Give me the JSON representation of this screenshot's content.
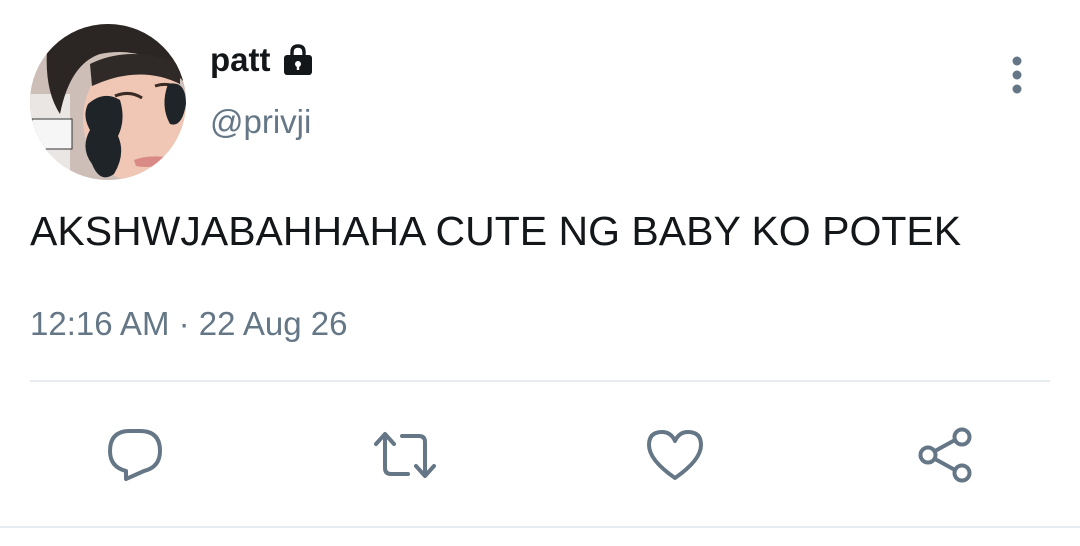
{
  "tweet": {
    "display_name": "patt",
    "handle": "@privji",
    "text": "AKSHWJABAHHAHA CUTE NG BABY KO POTEK",
    "time": "12:16 AM",
    "separator": "·",
    "date": "22 Aug 26",
    "protected": true
  },
  "icons": {
    "lock": "lock-icon",
    "more": "more-vertical-icon",
    "reply": "reply-icon",
    "retweet": "retweet-icon",
    "like": "heart-icon",
    "share": "share-icon"
  },
  "colors": {
    "text": "#14171a",
    "secondary": "#657786",
    "divider": "#e6ecf0"
  }
}
